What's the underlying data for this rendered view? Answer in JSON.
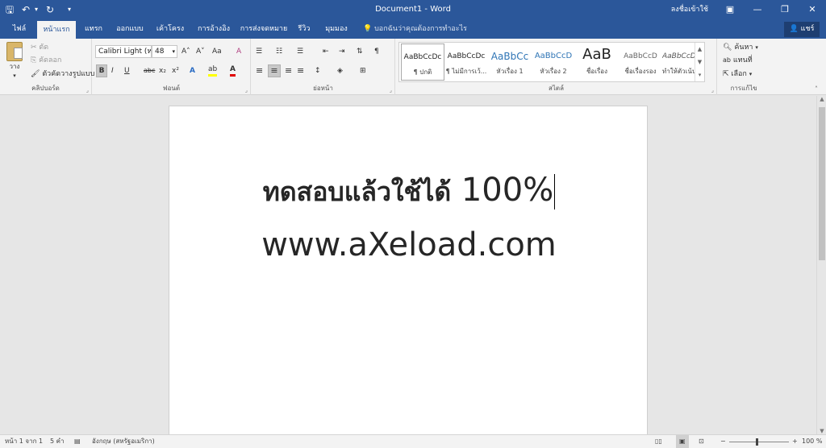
{
  "titlebar": {
    "title": "Document1 - Word",
    "signin": "ลงชื่อเข้าใช้",
    "qa_save": "🖫",
    "qa_undo": "↶",
    "qa_undo_arrow": "▾",
    "qa_redo": "↻",
    "qa_customize": "▾",
    "ribbon_display": "▣",
    "minimize": "—",
    "restore": "❐",
    "close": "✕"
  },
  "tabs": [
    {
      "label": "ไฟล์"
    },
    {
      "label": "หน้าแรก"
    },
    {
      "label": "แทรก"
    },
    {
      "label": "ออกแบบ"
    },
    {
      "label": "เค้าโครง"
    },
    {
      "label": "การอ้างอิง"
    },
    {
      "label": "การส่งจดหมาย"
    },
    {
      "label": "รีวิว"
    },
    {
      "label": "มุมมอง"
    }
  ],
  "tellme": "บอกฉันว่าคุณต้องการทำอะไร",
  "share": "แชร์",
  "clipboard": {
    "label": "คลิปบอร์ด",
    "paste": "วาง",
    "cut": "ตัด",
    "copy": "คัดลอก",
    "format_painter": "ตัวคัดวางรูปแบบ"
  },
  "font": {
    "label": "ฟอนต์",
    "font_name": "Calibri Light (ห",
    "font_size": "48",
    "grow": "A˄",
    "shrink": "A˅",
    "change_case": "Aa",
    "clear_format": "A",
    "bold": "B",
    "italic": "I",
    "underline": "U",
    "strike": "abc",
    "subscript": "x₂",
    "superscript": "x²",
    "text_effects": "A",
    "highlight": "ab",
    "font_color": "A"
  },
  "paragraph": {
    "label": "ย่อหน้า",
    "bullets": "☰",
    "numbering": "☷",
    "multilevel": "☰",
    "decrease_indent": "⇤",
    "increase_indent": "⇥",
    "sort": "⇅",
    "show_marks": "¶",
    "align_left": "≡",
    "align_center": "≡",
    "align_right": "≡",
    "justify": "≡",
    "line_spacing": "↕",
    "shading": "◈",
    "borders": "⊞"
  },
  "styles": {
    "label": "สไตล์",
    "items": [
      {
        "preview": "AaBbCcDc",
        "name": "¶ ปกติ"
      },
      {
        "preview": "AaBbCcDc",
        "name": "¶ ไม่มีการเว้..."
      },
      {
        "preview": "AaBbCc",
        "name": "หัวเรื่อง 1"
      },
      {
        "preview": "AaBbCcD",
        "name": "หัวเรื่อง 2"
      },
      {
        "preview": "AaB",
        "name": "ชื่อเรื่อง"
      },
      {
        "preview": "AaBbCcD",
        "name": "ชื่อเรื่องรอง"
      },
      {
        "preview": "AaBbCcDc",
        "name": "ทำให้ตัวเน้น..."
      }
    ],
    "scroll_up": "▲",
    "scroll_down": "▼",
    "more": "▾"
  },
  "editing": {
    "label": "การแก้ไข",
    "find": "ค้นหา",
    "replace": "แทนที่",
    "select": "เลือก"
  },
  "document": {
    "line1_thai": "ทดสอบแล้วใช้ได้",
    "line1_pct": "100%",
    "line2": "www.aXeload.com"
  },
  "status": {
    "page": "หน้า 1 จาก 1",
    "words": "5 คำ",
    "language": "อังกฤษ (สหรัฐอเมริกา)",
    "zoom": "100 %",
    "zoom_minus": "−",
    "zoom_plus": "+"
  }
}
